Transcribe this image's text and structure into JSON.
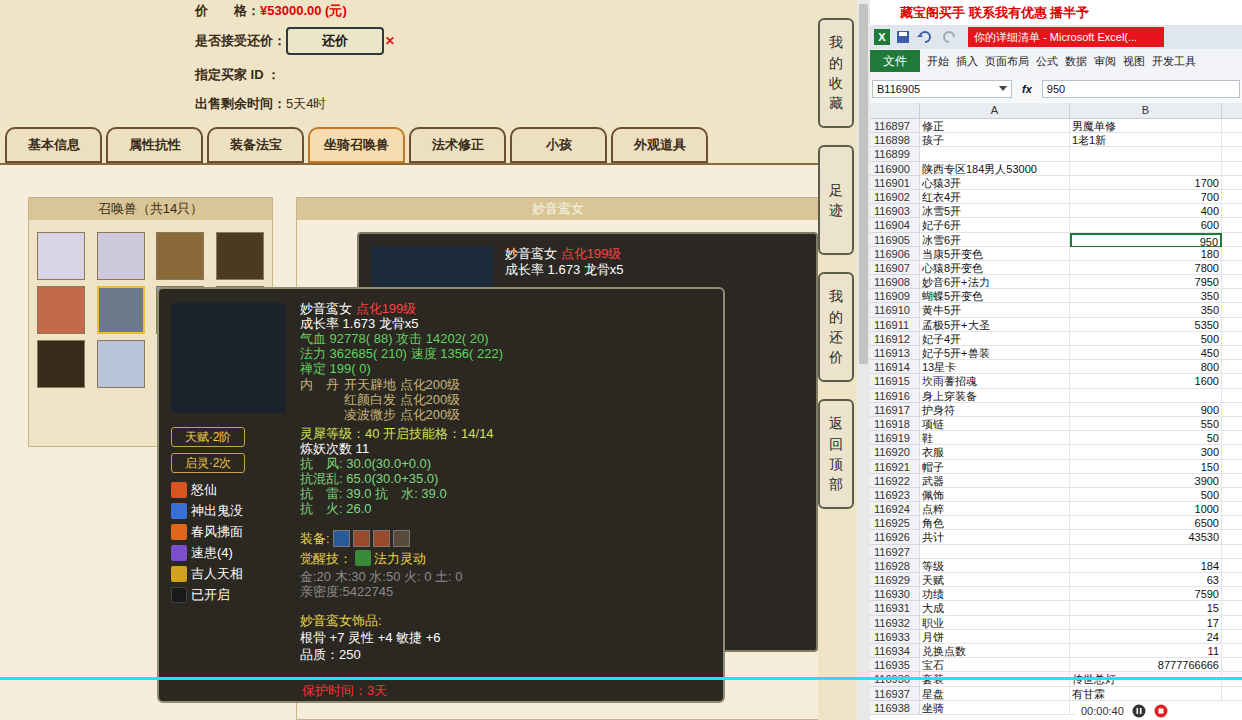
{
  "trade": {
    "price_label": "价　　格：",
    "price": "¥53000.00 (元)",
    "bargain_label": "是否接受还价：",
    "bargain_button": "还价",
    "bargain_close": "✕",
    "buyer_label": "指定买家 ID ：",
    "time_label": "出售剩余时间：",
    "time_value": "5天4时"
  },
  "tabs": [
    {
      "label": "基本信息",
      "selected": false
    },
    {
      "label": "属性抗性",
      "selected": false
    },
    {
      "label": "装备法宝",
      "selected": false
    },
    {
      "label": "坐骑召唤兽",
      "selected": true
    },
    {
      "label": "法术修正",
      "selected": false
    },
    {
      "label": "小孩",
      "selected": false
    },
    {
      "label": "外观道具",
      "selected": false
    }
  ],
  "side_buttons": [
    "我的收藏",
    "足迹",
    "我的还价",
    "返回顶部"
  ],
  "pet_panel": {
    "title": "召唤兽（共14只）",
    "pets": [
      {
        "selected": false
      },
      {
        "selected": false
      },
      {
        "selected": false
      },
      {
        "selected": false
      },
      {
        "selected": false
      },
      {
        "selected": true
      },
      {
        "selected": false
      },
      {
        "selected": false
      },
      {
        "selected": false
      },
      {
        "selected": false
      }
    ]
  },
  "detail_panel": {
    "title": "妙音鸾女",
    "card": {
      "name": "妙音鸾女",
      "level": "点化199级",
      "growth": "成长率 1.673 龙骨x5"
    }
  },
  "tooltip": {
    "name": "妙音鸾女",
    "level": "点化199级",
    "growth": "成长率 1.673 龙骨x5",
    "stats": [
      "气血 92778( 88) 攻击 14202( 20)",
      "法力 362685( 210) 速度 1356( 222)",
      "禅定 199( 0)"
    ],
    "neidan": {
      "label": "内　丹",
      "items": [
        "开天辟地 点化200级",
        "红颜白发 点化200级",
        "凌波微步 点化200级"
      ]
    },
    "lingxi": "灵犀等级：40 开启技能格：14/14",
    "refine": "炼妖次数 11",
    "resist": [
      "抗　风: 30.0(30.0+0.0)",
      "抗混乱: 65.0(30.0+35.0)",
      "抗　雷: 39.0 抗　水: 39.0",
      "抗　火: 26.0"
    ],
    "equip_label": "装备:",
    "awaken": {
      "label": "觉醒技：",
      "skill": "法力灵动"
    },
    "elements": "金:20 木:30 水:50 火: 0 土: 0",
    "intimacy": "亲密度:5422745",
    "ornament": {
      "title": "妙音鸾女饰品:",
      "attrs": "根骨 +7 灵性 +4 敏捷 +6",
      "quality": "品质：250"
    },
    "protect": "保护时间：3天",
    "badges": [
      "天赋·2阶",
      "启灵·2次"
    ],
    "skills": [
      {
        "name": "怒仙",
        "kind": "skill",
        "color": "#d9541e"
      },
      {
        "name": "神出鬼没",
        "kind": "skill",
        "color": "#3a6fd8"
      },
      {
        "name": "春风拂面",
        "kind": "skill",
        "color": "#e0661a"
      },
      {
        "name": "速患(4)",
        "kind": "skill",
        "color": "#7a4fc9"
      },
      {
        "name": "吉人天相",
        "kind": "skill",
        "color": "#d2a21e"
      },
      {
        "name": "已开启",
        "kind": "empty",
        "color": "#1a1a1a"
      }
    ]
  },
  "excel": {
    "banner": "藏宝阁买手 联系我有优惠 播半予",
    "app_icon": "X",
    "title": "你的详细清单 - Microsoft Excel(...",
    "file_tab": "文件",
    "ribbon_tabs": [
      "开始",
      "插入",
      "页面布局",
      "公式",
      "数据",
      "审阅",
      "视图",
      "开发工具"
    ],
    "name_box": "B116905",
    "fx": "fx",
    "formula": "950",
    "columns": [
      "A",
      "B"
    ],
    "rows": [
      {
        "n": "116897",
        "a": "修正",
        "b": "男魔单修",
        "kind": "text",
        "selected": false
      },
      {
        "n": "116898",
        "a": "孩子",
        "b": "1老1新",
        "kind": "text",
        "selected": false
      },
      {
        "n": "116899",
        "a": "",
        "b": "",
        "kind": "text",
        "selected": false
      },
      {
        "n": "116900",
        "a": "陕西专区184男人53000",
        "b": "",
        "kind": "text",
        "selected": false
      },
      {
        "n": "116901",
        "a": "心猿3开",
        "b": "1700",
        "kind": "number",
        "selected": false
      },
      {
        "n": "116902",
        "a": "红衣4开",
        "b": "700",
        "kind": "number",
        "selected": false
      },
      {
        "n": "116903",
        "a": "冰雪5开",
        "b": "400",
        "kind": "number",
        "selected": false
      },
      {
        "n": "116904",
        "a": "妃子6开",
        "b": "600",
        "kind": "number",
        "selected": false
      },
      {
        "n": "116905",
        "a": "冰雪6开",
        "b": "950",
        "kind": "number",
        "selected": true
      },
      {
        "n": "116906",
        "a": "当康5开变色",
        "b": "180",
        "kind": "number",
        "selected": false
      },
      {
        "n": "116907",
        "a": "心猿8开变色",
        "b": "7800",
        "kind": "number",
        "selected": false
      },
      {
        "n": "116908",
        "a": "妙音6开+法力",
        "b": "7950",
        "kind": "number",
        "selected": false
      },
      {
        "n": "116909",
        "a": "蝴蝶5开变色",
        "b": "350",
        "kind": "number",
        "selected": false
      },
      {
        "n": "116910",
        "a": "黄牛5开",
        "b": "350",
        "kind": "number",
        "selected": false
      },
      {
        "n": "116911",
        "a": "孟极5开+大圣",
        "b": "5350",
        "kind": "number",
        "selected": false
      },
      {
        "n": "116912",
        "a": "妃子4开",
        "b": "500",
        "kind": "number",
        "selected": false
      },
      {
        "n": "116913",
        "a": "妃子5开+兽装",
        "b": "450",
        "kind": "number",
        "selected": false
      },
      {
        "n": "116914",
        "a": "13星卡",
        "b": "800",
        "kind": "number",
        "selected": false
      },
      {
        "n": "116915",
        "a": "坎雨蓍招魂",
        "b": "1600",
        "kind": "number",
        "selected": false
      },
      {
        "n": "116916",
        "a": "身上穿装备",
        "b": "",
        "kind": "text",
        "selected": false
      },
      {
        "n": "116917",
        "a": "护身符",
        "b": "900",
        "kind": "number",
        "selected": false
      },
      {
        "n": "116918",
        "a": "项链",
        "b": "550",
        "kind": "number",
        "selected": false
      },
      {
        "n": "116919",
        "a": "鞋",
        "b": "50",
        "kind": "number",
        "selected": false
      },
      {
        "n": "116920",
        "a": "衣服",
        "b": "300",
        "kind": "number",
        "selected": false
      },
      {
        "n": "116921",
        "a": "帽子",
        "b": "150",
        "kind": "number",
        "selected": false
      },
      {
        "n": "116922",
        "a": "武器",
        "b": "3900",
        "kind": "number",
        "selected": false
      },
      {
        "n": "116923",
        "a": "佩饰",
        "b": "500",
        "kind": "number",
        "selected": false
      },
      {
        "n": "116924",
        "a": "点粹",
        "b": "1000",
        "kind": "number",
        "selected": false
      },
      {
        "n": "116925",
        "a": "角色",
        "b": "6500",
        "kind": "number",
        "selected": false
      },
      {
        "n": "116926",
        "a": "共计",
        "b": "43530",
        "kind": "number",
        "selected": false
      },
      {
        "n": "116927",
        "a": "",
        "b": "",
        "kind": "text",
        "selected": false
      },
      {
        "n": "116928",
        "a": "等级",
        "b": "184",
        "kind": "number",
        "selected": false
      },
      {
        "n": "116929",
        "a": "天赋",
        "b": "63",
        "kind": "number",
        "selected": false
      },
      {
        "n": "116930",
        "a": "功绩",
        "b": "7590",
        "kind": "number",
        "selected": false
      },
      {
        "n": "116931",
        "a": "大成",
        "b": "15",
        "kind": "number",
        "selected": false
      },
      {
        "n": "116932",
        "a": "职业",
        "b": "17",
        "kind": "number",
        "selected": false
      },
      {
        "n": "116933",
        "a": "月饼",
        "b": "24",
        "kind": "number",
        "selected": false
      },
      {
        "n": "116934",
        "a": "兑换点数",
        "b": "11",
        "kind": "number",
        "selected": false
      },
      {
        "n": "116935",
        "a": "宝石",
        "b": "8777766666",
        "kind": "number",
        "selected": false
      },
      {
        "n": "116936",
        "a": "套装",
        "b": "传世总灯",
        "kind": "text",
        "selected": false
      },
      {
        "n": "116937",
        "a": "星盘",
        "b": "有甘霖",
        "kind": "text",
        "selected": false
      },
      {
        "n": "116938",
        "a": "坐骑",
        "b": "",
        "kind": "text",
        "selected": false
      }
    ]
  },
  "recorder": {
    "timer": "00:00:40"
  }
}
